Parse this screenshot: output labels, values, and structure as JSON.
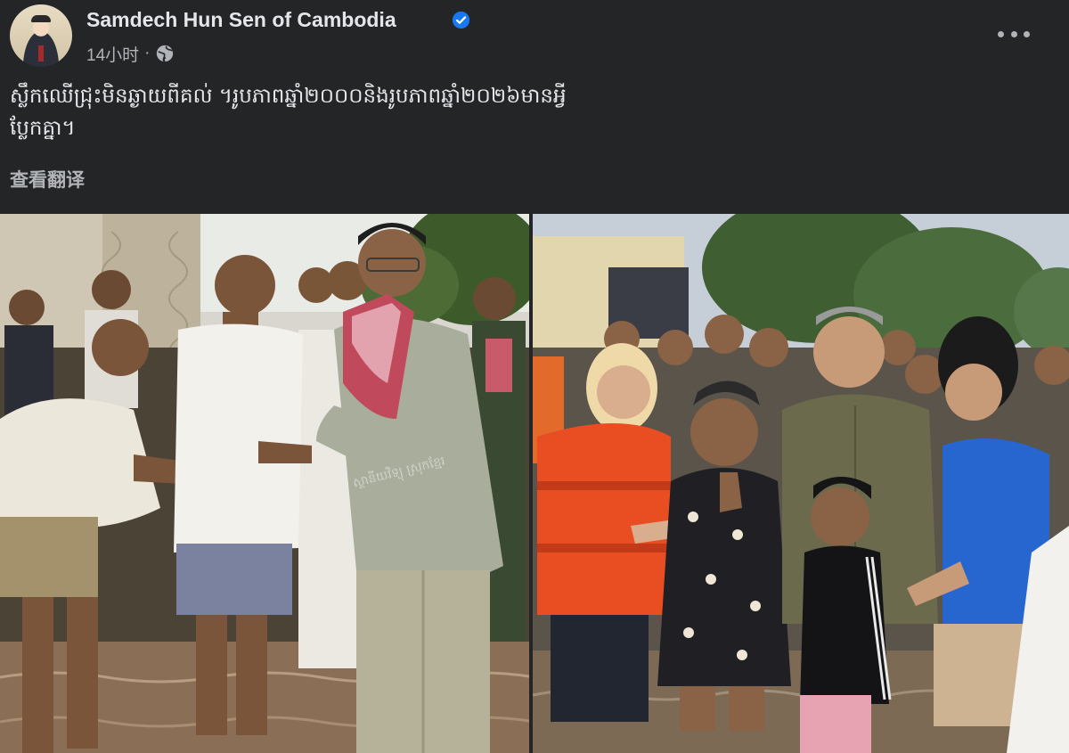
{
  "post": {
    "author": "Samdech Hun Sen of Cambodia",
    "time": "14小时",
    "separator": "·",
    "text_line1": "ស្លឹកឈើជ្រុះមិនឆ្ងាយពីគល់ ។រូបភាពឆ្នាំ២០០០និងរូបភាពឆ្នាំ២០២៦មានអ្វី",
    "text_line2": "ប្លែកគ្នា។",
    "translate": "查看翻译"
  },
  "photos": {
    "watermark": "ស្ថានីយវិទ្យុ ស្រុកខ្មែរ"
  },
  "colors": {
    "background": "#242526",
    "text_primary": "#e4e6eb",
    "text_secondary": "#b0b3b8",
    "verified_blue": "#1877f2"
  },
  "icons": {
    "verified": "verified-badge-icon",
    "privacy": "globe-icon",
    "more": "more-options-icon"
  }
}
